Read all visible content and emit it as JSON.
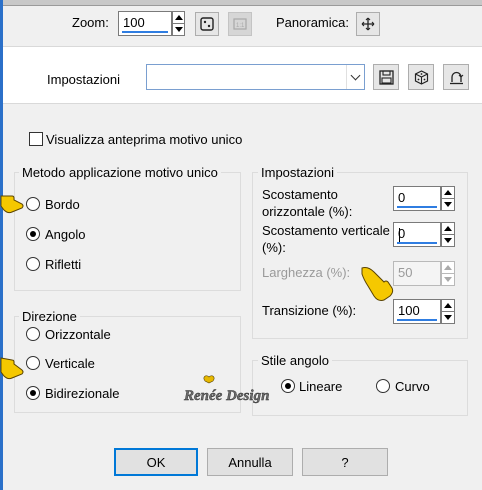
{
  "toolbar": {
    "zoom_label": "Zoom:",
    "zoom_value": "100",
    "pan_label": "Panoramica:"
  },
  "presets": {
    "label": "Impostazioni",
    "value": ""
  },
  "preview_checkbox": {
    "label": "Visualizza anteprima motivo unico",
    "checked": false
  },
  "method_group": {
    "title": "Metodo applicazione motivo unico",
    "options": [
      {
        "label": "Bordo",
        "selected": false
      },
      {
        "label": "Angolo",
        "selected": true
      },
      {
        "label": "Rifletti",
        "selected": false
      }
    ]
  },
  "settings_group": {
    "title": "Impostazioni",
    "h_offset": {
      "label_line1": "Scostamento",
      "label_line2": "orizzontale (%):",
      "value": "0"
    },
    "v_offset": {
      "label_line1": "Scostamento verticale",
      "label_line2": "(%):",
      "value": "0"
    },
    "width": {
      "label": "Larghezza (%):",
      "value": "50",
      "enabled": false
    },
    "transition": {
      "label": "Transizione (%):",
      "value": "100"
    }
  },
  "direction_group": {
    "title": "Direzione",
    "options": [
      {
        "label": "Orizzontale",
        "selected": false
      },
      {
        "label": "Verticale",
        "selected": false
      },
      {
        "label": "Bidirezionale",
        "selected": true
      }
    ]
  },
  "corner_group": {
    "title": "Stile angolo",
    "options": [
      {
        "label": "Lineare",
        "selected": true
      },
      {
        "label": "Curvo",
        "selected": false
      }
    ]
  },
  "watermark": {
    "text": "Renée Design"
  },
  "footer": {
    "ok_label": "OK",
    "cancel_label": "Annulla",
    "help_label": "?"
  },
  "colors": {
    "accent": "#0078d7",
    "pointer_hand": "#f5c800"
  }
}
